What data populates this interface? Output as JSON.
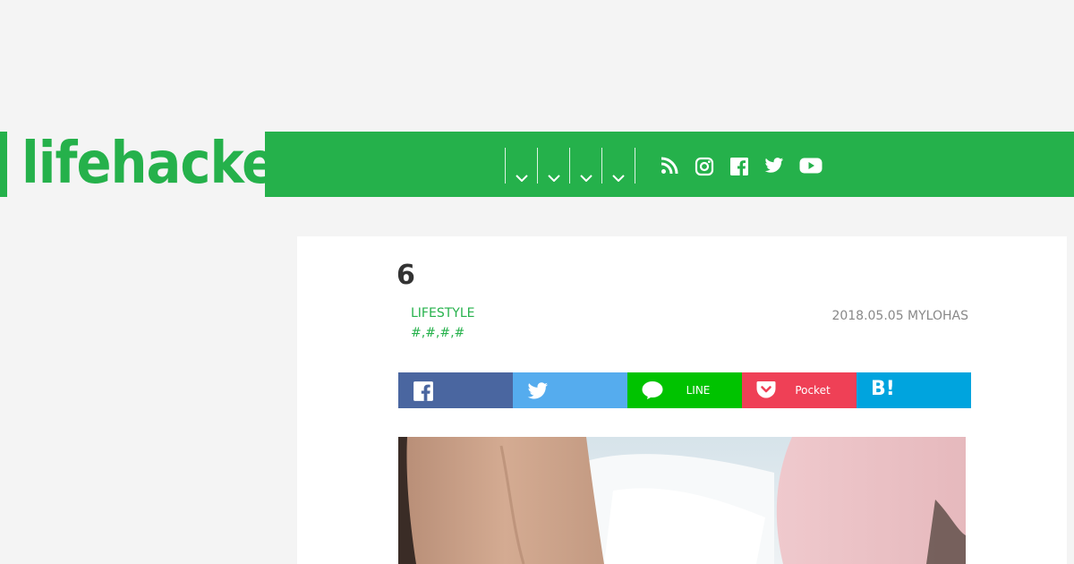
{
  "header": {
    "logo_text": "lifehacker",
    "nav_dropdowns": [
      "",
      "",
      "",
      ""
    ],
    "social_icons": [
      "rss-icon",
      "instagram-icon",
      "facebook-icon",
      "twitter-icon",
      "youtube-icon"
    ]
  },
  "article": {
    "title": "6",
    "category": "LIFESTYLE",
    "tags": "#,#,#,#",
    "meta": "2018.05.05 MYLOHAS"
  },
  "share": {
    "buttons": [
      {
        "name": "facebook",
        "label": "",
        "color": "#4a66a0"
      },
      {
        "name": "twitter",
        "label": "",
        "color": "#55acee"
      },
      {
        "name": "line",
        "label": "LINE",
        "color": "#00c300"
      },
      {
        "name": "pocket",
        "label": "Pocket",
        "color": "#ef4056"
      },
      {
        "name": "hatena",
        "label": "",
        "color": "#00a4de"
      }
    ]
  },
  "colors": {
    "brand": "#25b14b",
    "background": "#f4f4f4"
  }
}
